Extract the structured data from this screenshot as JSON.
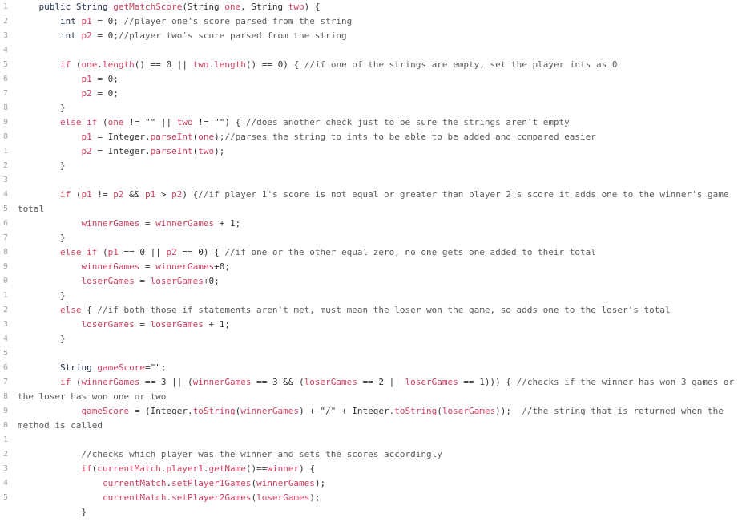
{
  "gutter_numbers": [
    "1",
    "2",
    "3",
    "4",
    "5",
    "6",
    "7",
    "8",
    "9",
    "0",
    "1",
    "2",
    "3",
    "4",
    "5",
    "6",
    "7",
    "8",
    "9",
    "0",
    "1",
    "2",
    "3",
    "4",
    "5",
    "6",
    "7",
    "8",
    "9",
    "0",
    "1",
    "2",
    "3",
    "4",
    "5"
  ],
  "lines": [
    {
      "indent": 1,
      "tokens": [
        [
          "kw",
          "public String "
        ],
        [
          "var",
          "getMatchScore"
        ],
        [
          "pl",
          "(String "
        ],
        [
          "var",
          "one"
        ],
        [
          "pl",
          ", String "
        ],
        [
          "var",
          "two"
        ],
        [
          "pl",
          ") {"
        ]
      ]
    },
    {
      "indent": 2,
      "tokens": [
        [
          "kw",
          "int "
        ],
        [
          "var",
          "p1"
        ],
        [
          "pl",
          " = 0; "
        ],
        [
          "cm",
          "//player one's score parsed from the string"
        ]
      ]
    },
    {
      "indent": 2,
      "tokens": [
        [
          "kw",
          "int "
        ],
        [
          "var",
          "p2"
        ],
        [
          "pl",
          " = 0;"
        ],
        [
          "cm",
          "//player two's score parsed from the string"
        ]
      ]
    },
    {
      "indent": 0,
      "tokens": []
    },
    {
      "indent": 2,
      "tokens": [
        [
          "var",
          "if"
        ],
        [
          "pl",
          " ("
        ],
        [
          "var",
          "one"
        ],
        [
          "pl",
          "."
        ],
        [
          "var",
          "length"
        ],
        [
          "pl",
          "() == 0 || "
        ],
        [
          "var",
          "two"
        ],
        [
          "pl",
          "."
        ],
        [
          "var",
          "length"
        ],
        [
          "pl",
          "() == 0) { "
        ],
        [
          "cm",
          "//if one of the strings are empty, set the player ints as 0"
        ]
      ]
    },
    {
      "indent": 3,
      "tokens": [
        [
          "var",
          "p1"
        ],
        [
          "pl",
          " = 0;"
        ]
      ]
    },
    {
      "indent": 3,
      "tokens": [
        [
          "var",
          "p2"
        ],
        [
          "pl",
          " = 0;"
        ]
      ]
    },
    {
      "indent": 2,
      "tokens": [
        [
          "pl",
          "}"
        ]
      ]
    },
    {
      "indent": 2,
      "tokens": [
        [
          "var",
          "else if"
        ],
        [
          "pl",
          " ("
        ],
        [
          "var",
          "one"
        ],
        [
          "pl",
          " != \"\" || "
        ],
        [
          "var",
          "two"
        ],
        [
          "pl",
          " != \"\") { "
        ],
        [
          "cm",
          "//does another check just to be sure the strings aren't empty"
        ]
      ]
    },
    {
      "indent": 3,
      "tokens": [
        [
          "var",
          "p1"
        ],
        [
          "pl",
          " = Integer."
        ],
        [
          "var",
          "parseInt"
        ],
        [
          "pl",
          "("
        ],
        [
          "var",
          "one"
        ],
        [
          "pl",
          ");"
        ],
        [
          "cm",
          "//parses the string to ints to be able to be added and compared easier"
        ]
      ]
    },
    {
      "indent": 3,
      "tokens": [
        [
          "var",
          "p2"
        ],
        [
          "pl",
          " = Integer."
        ],
        [
          "var",
          "parseInt"
        ],
        [
          "pl",
          "("
        ],
        [
          "var",
          "two"
        ],
        [
          "pl",
          ");"
        ]
      ]
    },
    {
      "indent": 2,
      "tokens": [
        [
          "pl",
          "}"
        ]
      ]
    },
    {
      "indent": 0,
      "tokens": []
    },
    {
      "indent": 2,
      "tokens": [
        [
          "var",
          "if"
        ],
        [
          "pl",
          " ("
        ],
        [
          "var",
          "p1"
        ],
        [
          "pl",
          " != "
        ],
        [
          "var",
          "p2"
        ],
        [
          "pl",
          " && "
        ],
        [
          "var",
          "p1"
        ],
        [
          "pl",
          " > "
        ],
        [
          "var",
          "p2"
        ],
        [
          "pl",
          ") {"
        ],
        [
          "cm",
          "//if player 1's score is not equal or greater than player 2's score it adds one to the winner's game"
        ]
      ]
    },
    {
      "indent": 0,
      "tokens": [
        [
          "cm",
          "total"
        ]
      ]
    },
    {
      "indent": 3,
      "tokens": [
        [
          "var",
          "winnerGames"
        ],
        [
          "pl",
          " = "
        ],
        [
          "var",
          "winnerGames"
        ],
        [
          "pl",
          " + 1;"
        ]
      ]
    },
    {
      "indent": 2,
      "tokens": [
        [
          "pl",
          "}"
        ]
      ]
    },
    {
      "indent": 2,
      "tokens": [
        [
          "var",
          "else if"
        ],
        [
          "pl",
          " ("
        ],
        [
          "var",
          "p1"
        ],
        [
          "pl",
          " == 0 || "
        ],
        [
          "var",
          "p2"
        ],
        [
          "pl",
          " == 0) { "
        ],
        [
          "cm",
          "//if one or the other equal zero, no one gets one added to their total"
        ]
      ]
    },
    {
      "indent": 3,
      "tokens": [
        [
          "var",
          "winnerGames"
        ],
        [
          "pl",
          " = "
        ],
        [
          "var",
          "winnerGames"
        ],
        [
          "pl",
          "+0;"
        ]
      ]
    },
    {
      "indent": 3,
      "tokens": [
        [
          "var",
          "loserGames"
        ],
        [
          "pl",
          " = "
        ],
        [
          "var",
          "loserGames"
        ],
        [
          "pl",
          "+0;"
        ]
      ]
    },
    {
      "indent": 2,
      "tokens": [
        [
          "pl",
          "}"
        ]
      ]
    },
    {
      "indent": 2,
      "tokens": [
        [
          "var",
          "else"
        ],
        [
          "pl",
          " { "
        ],
        [
          "cm",
          "//if both those if statements aren't met, must mean the loser won the game, so adds one to the loser's total"
        ]
      ]
    },
    {
      "indent": 3,
      "tokens": [
        [
          "var",
          "loserGames"
        ],
        [
          "pl",
          " = "
        ],
        [
          "var",
          "loserGames"
        ],
        [
          "pl",
          " + 1;"
        ]
      ]
    },
    {
      "indent": 2,
      "tokens": [
        [
          "pl",
          "}"
        ]
      ]
    },
    {
      "indent": 0,
      "tokens": []
    },
    {
      "indent": 2,
      "tokens": [
        [
          "kw",
          "String "
        ],
        [
          "var",
          "gameScore"
        ],
        [
          "pl",
          "=\"\";"
        ]
      ]
    },
    {
      "indent": 2,
      "tokens": [
        [
          "var",
          "if"
        ],
        [
          "pl",
          " ("
        ],
        [
          "var",
          "winnerGames"
        ],
        [
          "pl",
          " == 3 || ("
        ],
        [
          "var",
          "winnerGames"
        ],
        [
          "pl",
          " == 3 && ("
        ],
        [
          "var",
          "loserGames"
        ],
        [
          "pl",
          " == 2 || "
        ],
        [
          "var",
          "loserGames"
        ],
        [
          "pl",
          " == 1))) { "
        ],
        [
          "cm",
          "//checks if the winner has won 3 games or"
        ]
      ]
    },
    {
      "indent": 0,
      "tokens": [
        [
          "cm",
          "the loser has won one or two"
        ]
      ]
    },
    {
      "indent": 3,
      "tokens": [
        [
          "var",
          "gameScore"
        ],
        [
          "pl",
          " = (Integer."
        ],
        [
          "var",
          "toString"
        ],
        [
          "pl",
          "("
        ],
        [
          "var",
          "winnerGames"
        ],
        [
          "pl",
          ") + \"/\" + Integer."
        ],
        [
          "var",
          "toString"
        ],
        [
          "pl",
          "("
        ],
        [
          "var",
          "loserGames"
        ],
        [
          "pl",
          "));  "
        ],
        [
          "cm",
          "//the string that is returned when the"
        ]
      ]
    },
    {
      "indent": 0,
      "tokens": [
        [
          "cm",
          "method is called"
        ]
      ]
    },
    {
      "indent": 0,
      "tokens": []
    },
    {
      "indent": 3,
      "tokens": [
        [
          "cm",
          "//checks which player was the winner and sets the scores accordingly"
        ]
      ]
    },
    {
      "indent": 3,
      "tokens": [
        [
          "var",
          "if"
        ],
        [
          "pl",
          "("
        ],
        [
          "var",
          "currentMatch"
        ],
        [
          "pl",
          "."
        ],
        [
          "var",
          "player1"
        ],
        [
          "pl",
          "."
        ],
        [
          "var",
          "getName"
        ],
        [
          "pl",
          "()=="
        ],
        [
          "var",
          "winner"
        ],
        [
          "pl",
          ") {"
        ]
      ]
    },
    {
      "indent": 4,
      "tokens": [
        [
          "var",
          "currentMatch"
        ],
        [
          "pl",
          "."
        ],
        [
          "var",
          "setPlayer1Games"
        ],
        [
          "pl",
          "("
        ],
        [
          "var",
          "winnerGames"
        ],
        [
          "pl",
          ");"
        ]
      ]
    },
    {
      "indent": 4,
      "tokens": [
        [
          "var",
          "currentMatch"
        ],
        [
          "pl",
          "."
        ],
        [
          "var",
          "setPlayer2Games"
        ],
        [
          "pl",
          "("
        ],
        [
          "var",
          "loserGames"
        ],
        [
          "pl",
          ");"
        ]
      ]
    },
    {
      "indent": 3,
      "tokens": [
        [
          "pl",
          "}"
        ]
      ]
    }
  ]
}
